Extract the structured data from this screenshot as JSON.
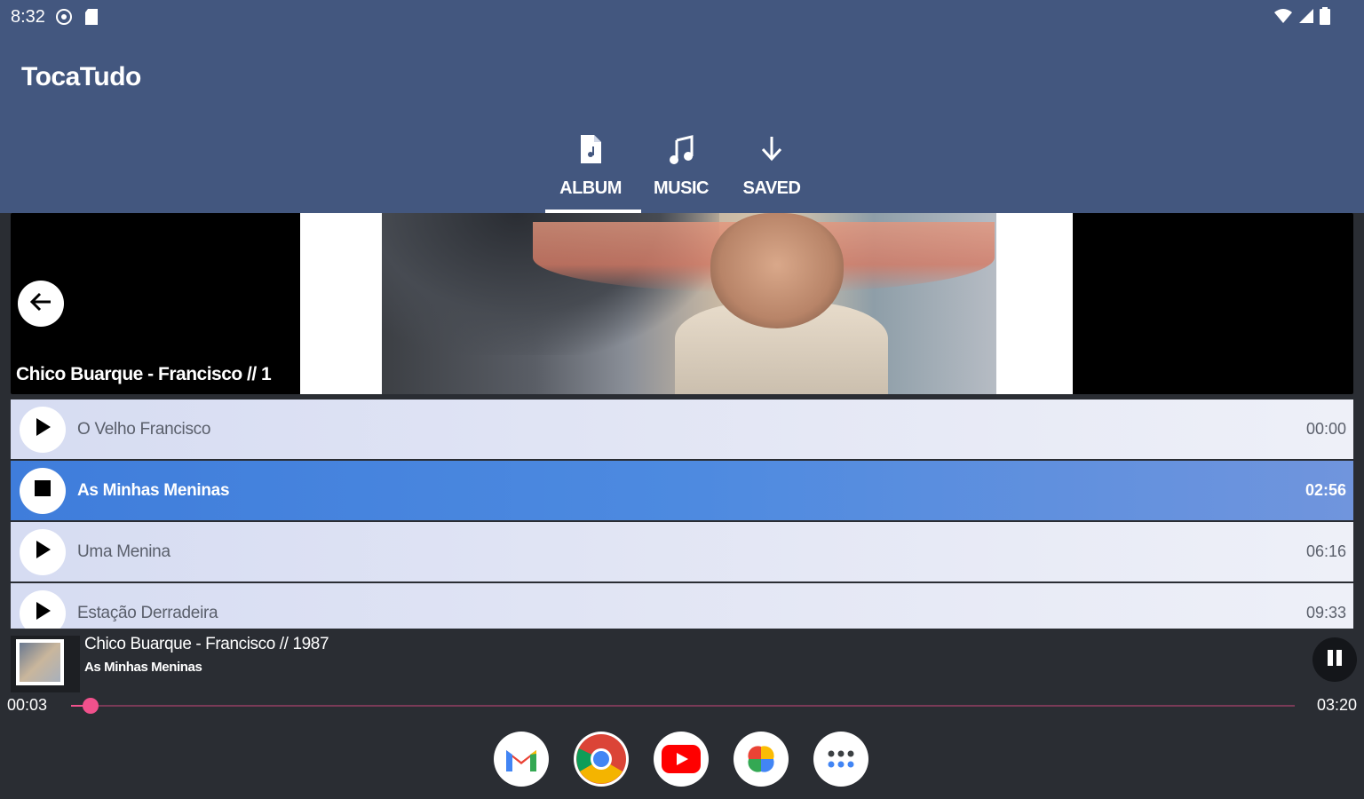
{
  "status_bar": {
    "time": "8:32",
    "left_icons": [
      "settings-icon",
      "sd-card-icon"
    ],
    "right_icons": [
      "wifi-icon",
      "signal-icon",
      "battery-icon"
    ]
  },
  "app": {
    "title": "TocaTudo"
  },
  "tabs": [
    {
      "label": "ALBUM",
      "icon": "document-icon",
      "active": true
    },
    {
      "label": "MUSIC",
      "icon": "music-note-icon",
      "active": false
    },
    {
      "label": "SAVED",
      "icon": "download-arrow-icon",
      "active": false
    }
  ],
  "album_banner": {
    "title": "Chico Buarque  -  Francisco // 1"
  },
  "tracks": [
    {
      "name": "O Velho Francisco",
      "duration": "00:00",
      "state": "idle"
    },
    {
      "name": "As Minhas Meninas",
      "duration": "02:56",
      "state": "playing"
    },
    {
      "name": "Uma Menina",
      "duration": "06:16",
      "state": "idle"
    },
    {
      "name": "Estação Derradeira",
      "duration": "09:33",
      "state": "idle"
    }
  ],
  "player": {
    "title": "Chico Buarque  -  Francisco // 1987",
    "subtitle": "As Minhas Meninas",
    "current_time": "00:03",
    "total_time": "03:20",
    "progress": 0.016
  },
  "dock": [
    {
      "name": "gmail-icon"
    },
    {
      "name": "chrome-icon"
    },
    {
      "name": "youtube-icon"
    },
    {
      "name": "google-photos-icon"
    },
    {
      "name": "app-drawer-icon"
    }
  ],
  "colors": {
    "app_bar": "#43577f",
    "playing_row": "#3f7ddb",
    "seek_accent": "#f0518c",
    "background_dark": "#2a2d33"
  }
}
